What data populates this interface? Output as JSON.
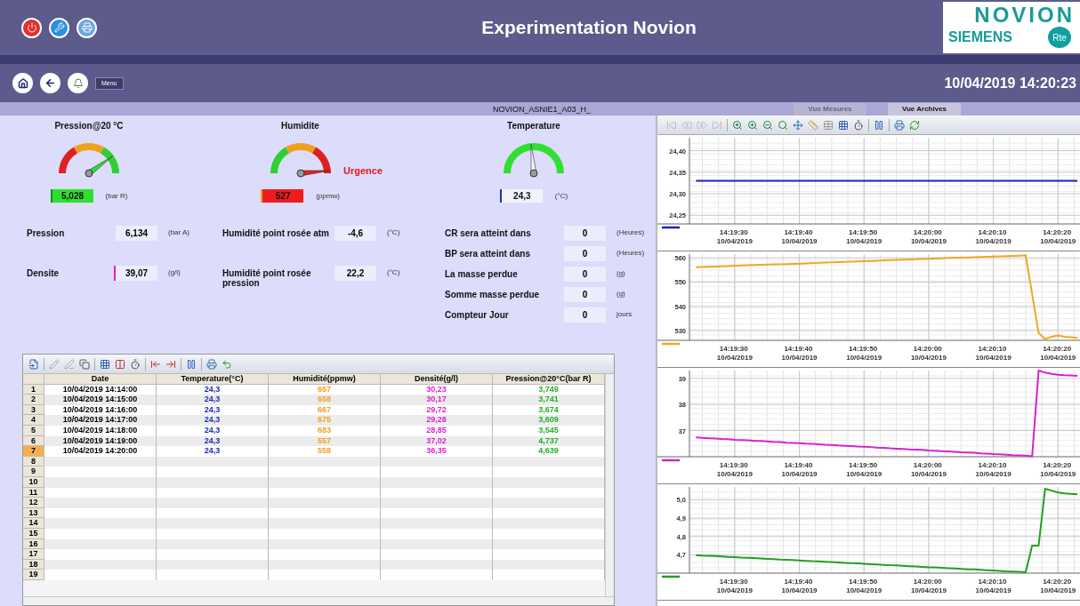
{
  "header": {
    "title": "Experimentation Novion",
    "logo": {
      "brand": "NOVION",
      "partner": "SIEMENS",
      "badge": "Rte"
    }
  },
  "nav": {
    "menu": "Menu",
    "datetime": "10/04/2019 14:20:23"
  },
  "subheader": {
    "station": "NOVION_ASNIE1_A03_H_",
    "tabs": [
      {
        "label": "Vue Mesures",
        "selected": false,
        "disabled": true
      },
      {
        "label": "Vue Archives",
        "selected": true,
        "disabled": false
      }
    ]
  },
  "gauges": [
    {
      "title": "Pression@20 °C",
      "value": "5,028",
      "unit": "(bar R)",
      "color": "#2ee02e",
      "marker": {
        "color": "#1a8a1a"
      },
      "zones": [
        {
          "color": "#e02020"
        },
        {
          "color": "#f0a020"
        },
        {
          "color": "#30d030"
        }
      ]
    },
    {
      "title": "Humidite",
      "value": "527",
      "unit": "(ppmw)",
      "color": "#ee1c1c",
      "marker": {
        "color": "#f0a030"
      },
      "alarm": "Urgence",
      "zones": [
        {
          "color": "#30d030"
        },
        {
          "color": "#f0a020"
        },
        {
          "color": "#e02020"
        }
      ]
    },
    {
      "title": "Temperature",
      "value": "24,3",
      "unit": "(°C)",
      "color": "#f2f2ff",
      "marker": {
        "color": "#2030c0"
      },
      "zones": [
        {
          "color": "#30e030"
        }
      ]
    }
  ],
  "parameters": [
    [
      {
        "label": "Pression",
        "value": "6,134",
        "unit": "(bar A)"
      },
      {
        "label": "Densite",
        "value": "39,07",
        "unit": "(g/l)",
        "marker": {
          "color": "#e020c0"
        }
      }
    ],
    [
      {
        "label": "Humidité point rosée atm",
        "value": "-4,6",
        "unit": "(°C)"
      },
      {
        "label": "Humidité point rosée pression",
        "value": "22,2",
        "unit": "(°C)"
      }
    ],
    [
      {
        "label": "CR  sera atteint dans",
        "value": "0",
        "unit": "(Heures)"
      },
      {
        "label": "BP  sera atteint dans",
        "value": "0",
        "unit": "(Heures)"
      },
      {
        "label": "La masse perdue",
        "value": "0",
        "unit": "(g)"
      },
      {
        "label": "Somme masse perdue",
        "value": "0",
        "unit": "(g)"
      },
      {
        "label": "Compteur Jour",
        "value": "0",
        "unit": "jours"
      }
    ]
  ],
  "table": {
    "columns": [
      {
        "label": "Date",
        "color": "#000000"
      },
      {
        "label": "Temperature(°C)",
        "color": "#1c2ab8"
      },
      {
        "label": "Humidité(ppmw)",
        "color": "#f0a020"
      },
      {
        "label": "Densité(g/l)",
        "color": "#e020d0"
      },
      {
        "label": "Pression@20°C(bar R)",
        "color": "#20b020"
      }
    ],
    "rows": [
      {
        "number": "1",
        "selected": false,
        "cells": [
          "10/04/2019 14:14:00",
          "24,3",
          "657",
          "30,23",
          "3,749"
        ]
      },
      {
        "number": "2",
        "selected": false,
        "cells": [
          "10/04/2019 14:15:00",
          "24,3",
          "658",
          "30,17",
          "3,741"
        ]
      },
      {
        "number": "3",
        "selected": false,
        "cells": [
          "10/04/2019 14:16:00",
          "24,3",
          "667",
          "29,72",
          "3,674"
        ]
      },
      {
        "number": "4",
        "selected": false,
        "cells": [
          "10/04/2019 14:17:00",
          "24,3",
          "675",
          "29,28",
          "3,609"
        ]
      },
      {
        "number": "5",
        "selected": false,
        "cells": [
          "10/04/2019 14:18:00",
          "24,3",
          "683",
          "28,85",
          "3,545"
        ]
      },
      {
        "number": "6",
        "selected": false,
        "cells": [
          "10/04/2019 14:19:00",
          "24,3",
          "557",
          "37,02",
          "4,737"
        ]
      },
      {
        "number": "7",
        "selected": true,
        "cells": [
          "10/04/2019 14:20:00",
          "24,3",
          "558",
          "36,35",
          "4,639"
        ]
      },
      {
        "number": "8",
        "selected": false
      },
      {
        "number": "9",
        "selected": false
      },
      {
        "number": "10",
        "selected": false
      },
      {
        "number": "11",
        "selected": false
      },
      {
        "number": "12",
        "selected": false
      },
      {
        "number": "13",
        "selected": false
      },
      {
        "number": "14",
        "selected": false
      },
      {
        "number": "15",
        "selected": false
      },
      {
        "number": "16",
        "selected": false
      },
      {
        "number": "17",
        "selected": false
      },
      {
        "number": "18",
        "selected": false
      },
      {
        "number": "19",
        "selected": false
      }
    ]
  },
  "charts": [
    {
      "chart_data": {
        "type": "line",
        "categories": [
          null,
          null,
          null,
          null,
          null,
          null,
          "14:19:30 10/04/2019",
          null,
          null,
          null,
          null,
          null,
          null,
          null,
          null,
          null,
          "14:19:40 10/04/2019",
          null,
          null,
          null,
          null,
          null,
          null,
          null,
          null,
          null,
          "14:19:50 10/04/2019",
          null,
          null,
          null,
          null,
          null,
          null,
          null,
          null,
          null,
          "14:20:00 10/04/2019",
          null,
          null,
          null,
          null,
          null,
          null,
          null,
          null,
          null,
          "14:20:10 10/04/2019",
          null,
          null,
          null,
          null,
          null,
          null,
          null,
          null,
          null,
          "14:20:20 10/04/2019",
          null,
          null,
          null
        ],
        "series": [
          {
            "color": "#1c22b0",
            "values": [
              24.33,
              24.33,
              24.33,
              24.33,
              24.33,
              24.33,
              24.33,
              24.33,
              24.33,
              24.33,
              24.33,
              24.33,
              24.33,
              24.33,
              24.33,
              24.33,
              24.33,
              24.33,
              24.33,
              24.33,
              24.33,
              24.33,
              24.33,
              24.33,
              24.33,
              24.33,
              24.33,
              24.33,
              24.33,
              24.33,
              24.33,
              24.33,
              24.33,
              24.33,
              24.33,
              24.33,
              24.33,
              24.33,
              24.33,
              24.33,
              24.33,
              24.33,
              24.33,
              24.33,
              24.33,
              24.33,
              24.33,
              24.33,
              24.33,
              24.33,
              24.33,
              24.33,
              24.33,
              24.33,
              24.33,
              24.33,
              24.33,
              24.33,
              24.33,
              24.33
            ]
          }
        ],
        "grid": true,
        "ylim": [
          24.23,
          24.43
        ],
        "yticks": [
          {
            "value": 24.25,
            "label": "24,25"
          },
          {
            "value": 24.3,
            "label": "24,30"
          },
          {
            "value": 24.35,
            "label": "24,35"
          },
          {
            "value": 24.4,
            "label": "24,40"
          }
        ]
      }
    },
    {
      "chart_data": {
        "type": "line",
        "categories": [
          null,
          null,
          null,
          null,
          null,
          null,
          "14:19:30 10/04/2019",
          null,
          null,
          null,
          null,
          null,
          null,
          null,
          null,
          null,
          "14:19:40 10/04/2019",
          null,
          null,
          null,
          null,
          null,
          null,
          null,
          null,
          null,
          "14:19:50 10/04/2019",
          null,
          null,
          null,
          null,
          null,
          null,
          null,
          null,
          null,
          "14:20:00 10/04/2019",
          null,
          null,
          null,
          null,
          null,
          null,
          null,
          null,
          null,
          "14:20:10 10/04/2019",
          null,
          null,
          null,
          null,
          null,
          null,
          null,
          null,
          null,
          "14:20:20 10/04/2019",
          null,
          null,
          null
        ],
        "series": [
          {
            "color": "#f0a820",
            "values": [
              556.1,
              556.2,
              556.3,
              556.4,
              556.5,
              556.6,
              556.7,
              556.8,
              556.9,
              557.0,
              557.1,
              557.2,
              557.3,
              557.3,
              557.4,
              557.5,
              557.6,
              557.7,
              557.8,
              557.9,
              558.0,
              558.1,
              558.2,
              558.3,
              558.4,
              558.5,
              558.6,
              558.7,
              558.8,
              558.9,
              559.0,
              559.1,
              559.2,
              559.3,
              559.4,
              559.5,
              559.6,
              559.7,
              559.8,
              559.9,
              560.0,
              560.0,
              560.1,
              560.2,
              560.3,
              560.4,
              560.5,
              560.6,
              560.7,
              560.8,
              560.9,
              561.0,
              545,
              529,
              526.5,
              527.5,
              528,
              527.5,
              527.3,
              527
            ]
          }
        ],
        "grid": true,
        "ylim": [
          526,
          561.5
        ],
        "yticks": [
          530,
          540,
          550,
          560
        ]
      }
    },
    {
      "chart_data": {
        "type": "line",
        "categories": [
          null,
          null,
          null,
          null,
          null,
          null,
          "14:19:30 10/04/2019",
          null,
          null,
          null,
          null,
          null,
          null,
          null,
          null,
          null,
          "14:19:40 10/04/2019",
          null,
          null,
          null,
          null,
          null,
          null,
          null,
          null,
          null,
          "14:19:50 10/04/2019",
          null,
          null,
          null,
          null,
          null,
          null,
          null,
          null,
          null,
          "14:20:00 10/04/2019",
          null,
          null,
          null,
          null,
          null,
          null,
          null,
          null,
          null,
          "14:20:10 10/04/2019",
          null,
          null,
          null,
          null,
          null,
          null,
          null,
          null,
          null,
          "14:20:20 10/04/2019",
          null,
          null,
          null
        ],
        "series": [
          {
            "color": "#d820d0",
            "values": [
              36.74,
              36.72,
              36.71,
              36.7,
              36.68,
              36.67,
              36.65,
              36.64,
              36.63,
              36.61,
              36.6,
              36.59,
              36.57,
              36.56,
              36.54,
              36.53,
              36.52,
              36.5,
              36.49,
              36.48,
              36.46,
              36.45,
              36.43,
              36.42,
              36.41,
              36.39,
              36.38,
              36.37,
              36.35,
              36.34,
              36.32,
              36.31,
              36.3,
              36.28,
              36.27,
              36.26,
              36.24,
              36.23,
              36.21,
              36.2,
              36.19,
              36.17,
              36.16,
              36.15,
              36.13,
              36.12,
              36.1,
              36.09,
              36.08,
              36.06,
              36.05,
              36.04,
              36.02,
              39.3,
              39.22,
              39.17,
              39.14,
              39.12,
              39.11,
              39.1
            ]
          }
        ],
        "grid": true,
        "ylim": [
          36,
          39.3
        ],
        "yticks": [
          37,
          38,
          39
        ]
      }
    },
    {
      "chart_data": {
        "type": "line",
        "categories": [
          null,
          null,
          null,
          null,
          null,
          null,
          "14:19:30 10/04/2019",
          null,
          null,
          null,
          null,
          null,
          null,
          null,
          null,
          null,
          "14:19:40 10/04/2019",
          null,
          null,
          null,
          null,
          null,
          null,
          null,
          null,
          null,
          "14:19:50 10/04/2019",
          null,
          null,
          null,
          null,
          null,
          null,
          null,
          null,
          null,
          "14:20:00 10/04/2019",
          null,
          null,
          null,
          null,
          null,
          null,
          null,
          null,
          null,
          "14:20:10 10/04/2019",
          null,
          null,
          null,
          null,
          null,
          null,
          null,
          null,
          null,
          "14:20:20 10/04/2019",
          null,
          null,
          null
        ],
        "series": [
          {
            "color": "#20a020",
            "values": [
              4.698,
              4.696,
              4.695,
              4.693,
              4.691,
              4.689,
              4.687,
              4.685,
              4.684,
              4.682,
              4.68,
              4.678,
              4.676,
              4.674,
              4.673,
              4.671,
              4.669,
              4.667,
              4.665,
              4.664,
              4.662,
              4.66,
              4.658,
              4.656,
              4.654,
              4.653,
              4.651,
              4.649,
              4.647,
              4.645,
              4.643,
              4.642,
              4.64,
              4.638,
              4.636,
              4.634,
              4.632,
              4.631,
              4.629,
              4.627,
              4.625,
              4.623,
              4.621,
              4.62,
              4.618,
              4.616,
              4.614,
              4.612,
              4.61,
              4.609,
              4.607,
              4.605,
              4.75,
              4.75,
              5.06,
              5.05,
              5.04,
              5.035,
              5.032,
              5.03
            ]
          }
        ],
        "grid": true,
        "ylim": [
          4.6,
          5.07
        ],
        "yticks": [
          {
            "value": 4.7,
            "label": "4,7"
          },
          {
            "value": 4.8,
            "label": "4,8"
          },
          {
            "value": 4.9,
            "label": "4,9"
          },
          {
            "value": 5.0,
            "label": "5,0"
          }
        ]
      }
    }
  ]
}
